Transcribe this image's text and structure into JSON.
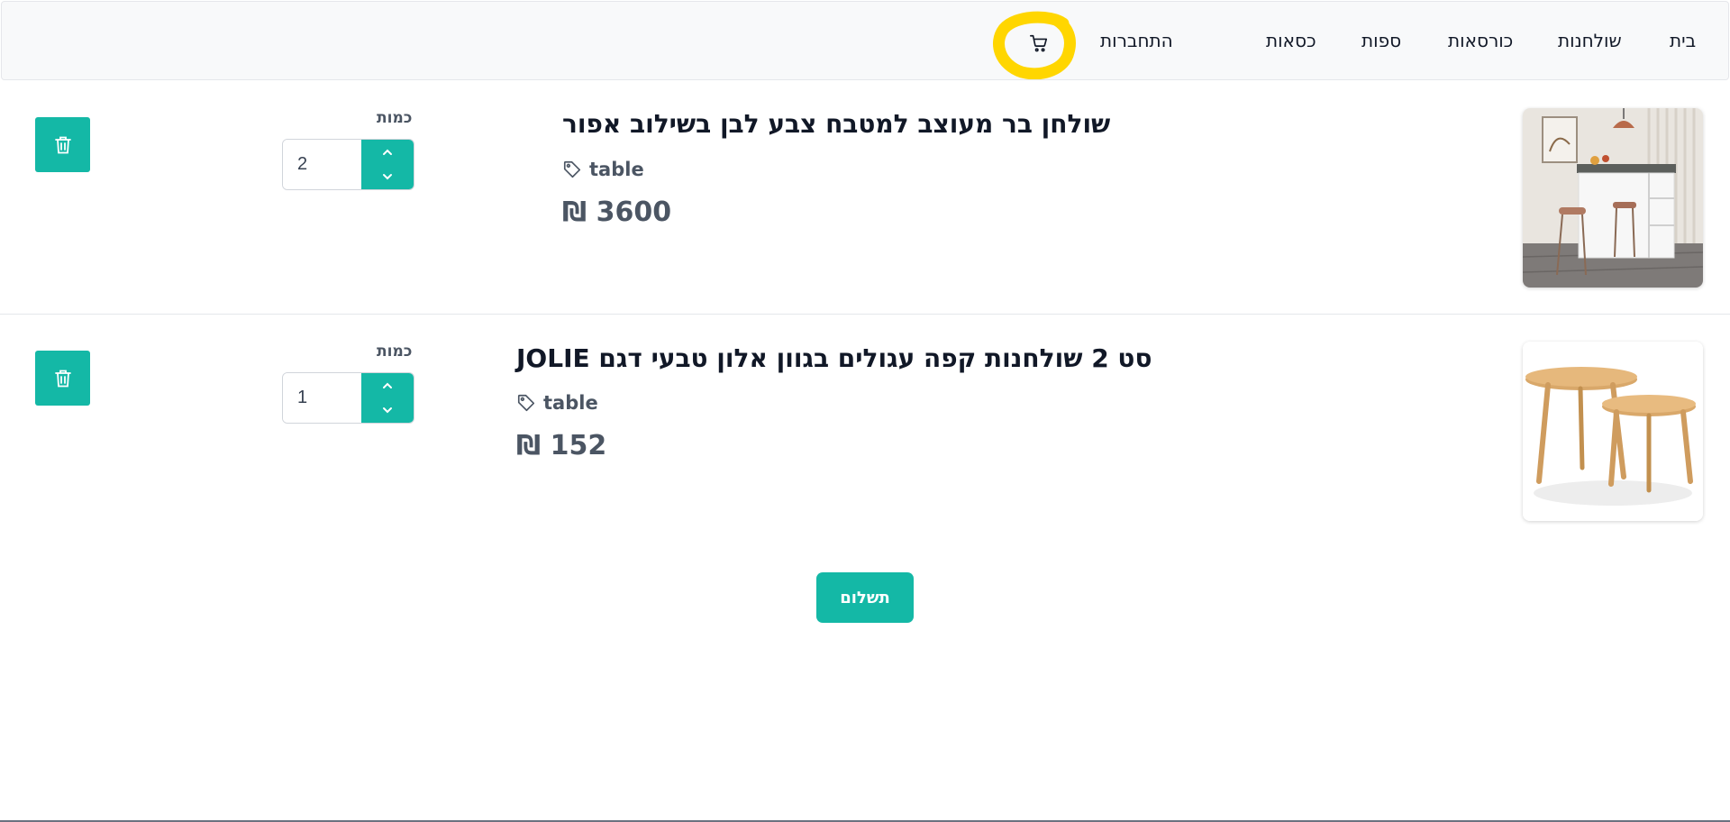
{
  "nav": {
    "home": "בית",
    "tables": "שולחנות",
    "armchairs": "כורסאות",
    "sofas": "ספות",
    "chairs": "כסאות",
    "login": "התחברות"
  },
  "colors": {
    "accent": "#14b8a6",
    "highlight": "#ffd600",
    "navbar_bg": "#f8f9fa"
  },
  "cart": {
    "items": [
      {
        "title": "שולחן בר מעוצב למטבח צבע לבן בשילוב אפור",
        "tag": "table",
        "price": "3600 ₪",
        "qty_label": "כמות",
        "qty": "2"
      },
      {
        "title": "סט 2 שולחנות קפה עגולים בגוון אלון טבעי דגם JOLIE",
        "tag": "table",
        "price": "152 ₪",
        "qty_label": "כמות",
        "qty": "1"
      }
    ],
    "checkout_label": "תשלום"
  }
}
